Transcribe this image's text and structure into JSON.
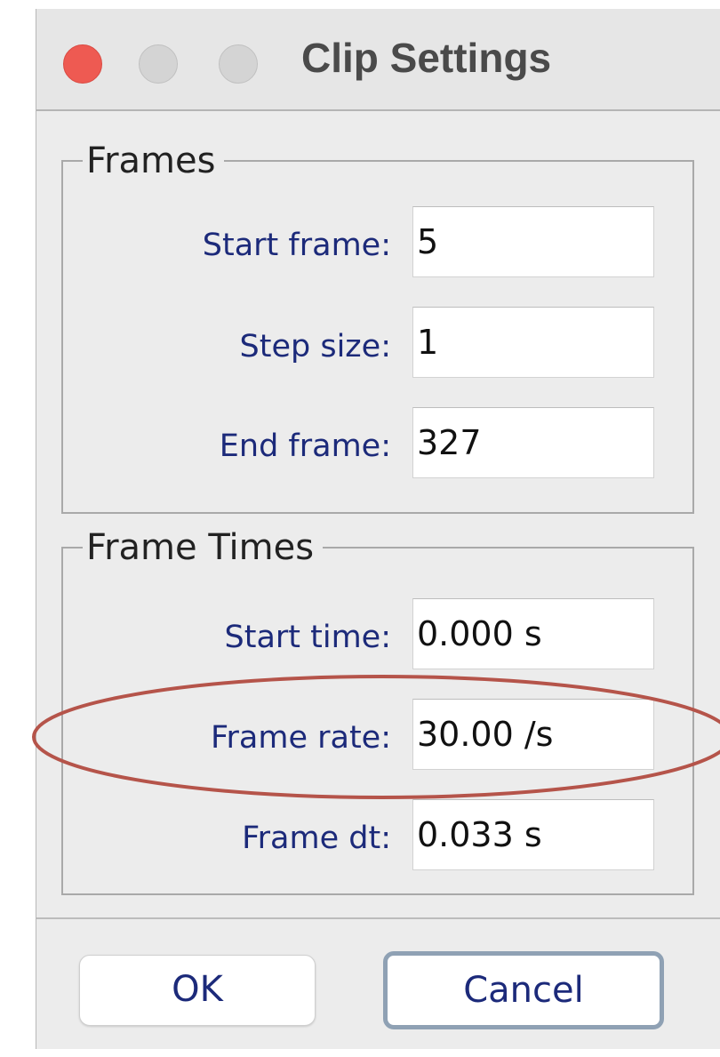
{
  "window": {
    "title": "Clip Settings",
    "controls": [
      "close",
      "minimize",
      "maximize"
    ]
  },
  "frames_group": {
    "title": "Frames",
    "fields": [
      {
        "label": "Start frame:",
        "value": "5"
      },
      {
        "label": "Step size:",
        "value": "1"
      },
      {
        "label": "End frame:",
        "value": "327"
      }
    ]
  },
  "times_group": {
    "title": "Frame Times",
    "fields": [
      {
        "label": "Start time:",
        "value": "0.000 s"
      },
      {
        "label": "Frame rate:",
        "value": "30.00 /s"
      },
      {
        "label": "Frame dt:",
        "value": "0.033 s"
      }
    ]
  },
  "buttons": {
    "ok": "OK",
    "cancel": "Cancel"
  },
  "colors": {
    "close_button": "#ee5a52",
    "label_text": "#1c2a7a",
    "annotation_ellipse": "#b5544a"
  }
}
